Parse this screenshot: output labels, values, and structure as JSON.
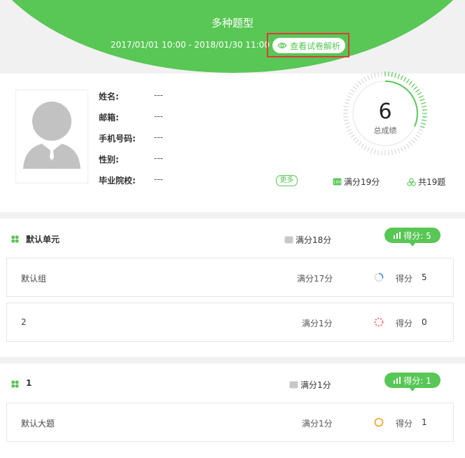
{
  "header": {
    "title": "多种题型",
    "dates": "2017/01/01 10:00 - 2018/01/30 11:00",
    "view_button": "查看试卷解析",
    "view_icon": "eye-icon"
  },
  "profile": {
    "fields": [
      {
        "label": "姓名:",
        "value": "---"
      },
      {
        "label": "邮箱:",
        "value": "---"
      },
      {
        "label": "手机号码:",
        "value": "---"
      },
      {
        "label": "性别:",
        "value": "---"
      },
      {
        "label": "毕业院校:",
        "value": "---"
      }
    ],
    "more_label": "更多",
    "full_score": "满分19分",
    "question_count": "共19题",
    "score": "6",
    "score_label": "总成绩",
    "score_fraction": 0.3158,
    "accent": "#58c755"
  },
  "units": [
    {
      "title": "默认单元",
      "full": "满分18分",
      "score_pill": "得分: 5",
      "groups": [
        {
          "name": "默认组",
          "full": "满分17分",
          "score_label": "得分",
          "score": "5",
          "ring_color": "#3d8ee6",
          "ratio": 0.29
        },
        {
          "name": "2",
          "full": "满分1分",
          "score_label": "得分",
          "score": "0",
          "ring_color": "#e95050",
          "ratio": 0
        }
      ]
    },
    {
      "title": "1",
      "full": "满分1分",
      "score_pill": "得分: 1",
      "groups": [
        {
          "name": "默认大题",
          "full": "满分1分",
          "score_label": "得分",
          "score": "1",
          "ring_color": "#f0a020",
          "ratio": 1
        }
      ]
    }
  ]
}
